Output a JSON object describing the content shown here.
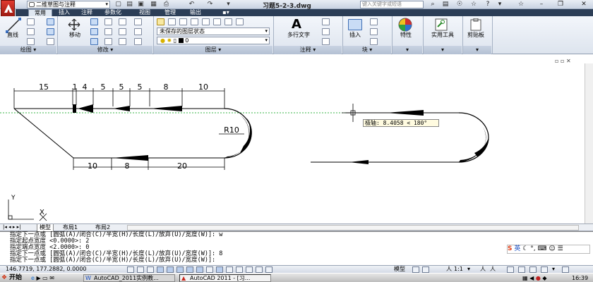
{
  "titlebar": {
    "workspace": "二维草图与注释",
    "document_title": "习题5-2-3.dwg",
    "search_placeholder": "键入关键字或短语"
  },
  "ribbon_tabs": [
    "常用",
    "插入",
    "注释",
    "参数化",
    "视图",
    "管理",
    "输出"
  ],
  "ribbon": {
    "draw": {
      "label": "绘图",
      "line_label": "直线"
    },
    "modify": {
      "label": "修改",
      "move_label": "移动"
    },
    "layers": {
      "label": "图层",
      "state_value": "未保存的图层状态",
      "layer_value": "0"
    },
    "annotation": {
      "label": "注释",
      "mtext_label": "多行文字"
    },
    "block": {
      "label": "块",
      "insert_label": "插入"
    },
    "properties": {
      "label": "特性"
    },
    "utilities": {
      "label": "实用工具"
    },
    "clipboard": {
      "label": "剪贴板"
    }
  },
  "drawing": {
    "dims_top": [
      "15",
      "1",
      "4",
      "5",
      "5",
      "5",
      "8",
      "10"
    ],
    "dims_bottom": [
      "10",
      "8",
      "20"
    ],
    "radius_label": "R10",
    "tooltip": "极轴: 8.4058 < 180°",
    "ucs_y": "Y",
    "ucs_x": "X"
  },
  "layout_tabs": [
    "模型",
    "布局1",
    "布局2"
  ],
  "command_lines": [
    "指定下一点或 [圆弧(A)/闭合(C)/半宽(H)/长度(L)/放弃(U)/宽度(W)]: w",
    "指定起点宽度 <0.0000>: 2",
    "指定端点宽度 <2.0000>: 0",
    "指定下一点或 [圆弧(A)/闭合(C)/半宽(H)/长度(L)/放弃(U)/宽度(W)]: 8",
    "指定下一点或 [圆弧(A)/闭合(C)/半宽(H)/长度(L)/放弃(U)/宽度(W)]:"
  ],
  "ime": {
    "label": "英"
  },
  "statusbar": {
    "coords": "146.7719, 177.2882, 0.0000",
    "model_label": "模型",
    "scale_label": "1:1"
  },
  "taskbar": {
    "start_label": "开始",
    "tasks": [
      "AutoCAD_2011实例教...",
      "AutoCAD 2011 - [习..."
    ],
    "clock": "16:39"
  },
  "colors": {
    "accent": "#2c3e57",
    "logo": "#c8281e",
    "guide": "#39b54a"
  }
}
